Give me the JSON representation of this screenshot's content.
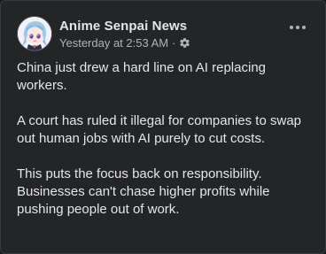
{
  "post": {
    "author": "Anime Senpai News",
    "timestamp": "Yesterday at 2:53 AM",
    "separator": "·",
    "avatar_icon": "anime-character-avatar",
    "audience_icon": "gear-icon",
    "more_icon": "more-options-icon",
    "paragraphs": [
      "China just drew a hard line on AI replacing workers.",
      "A court has ruled it illegal for companies to swap out human jobs with AI purely to cut costs.",
      "This puts the focus back on responsibility. Businesses can't chase higher profits while pushing people out of work."
    ]
  },
  "colors": {
    "background": "#242526",
    "primary_text": "#e4e6eb",
    "secondary_text": "#b0b3b8"
  }
}
